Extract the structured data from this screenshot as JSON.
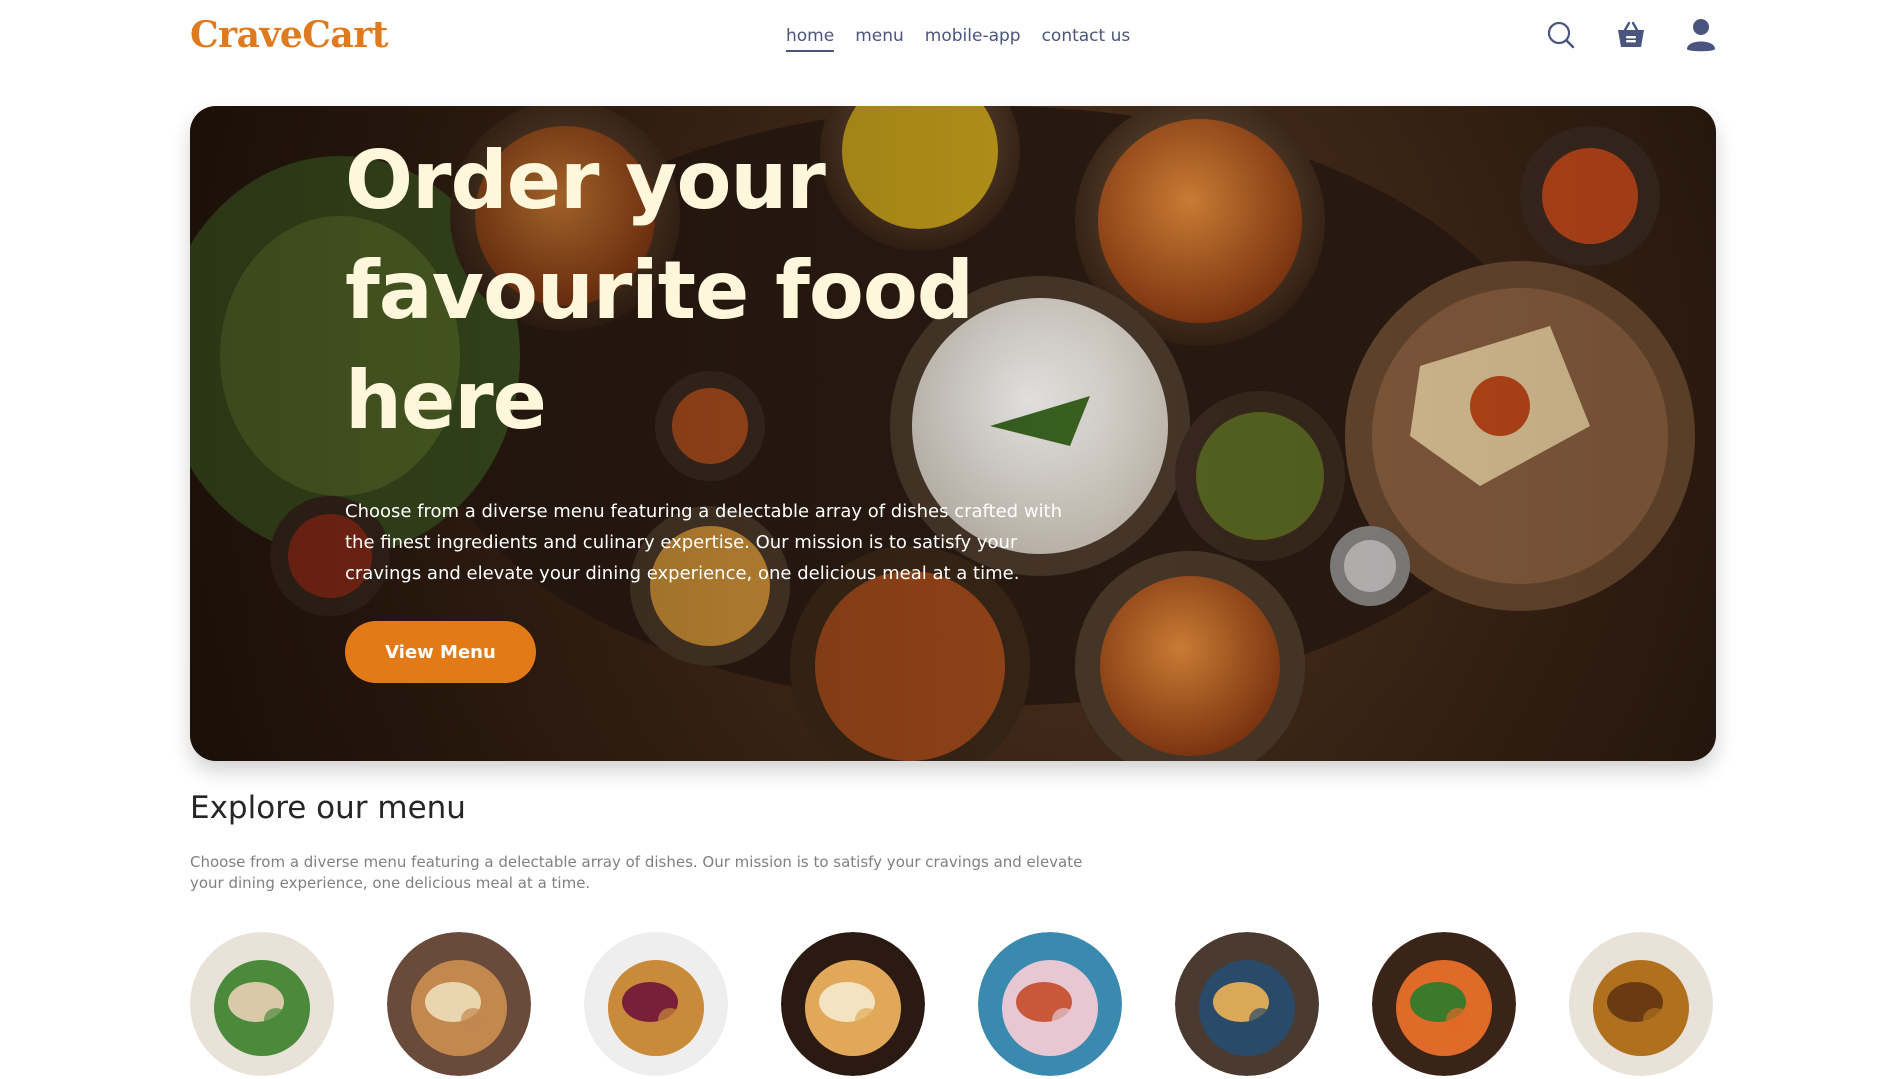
{
  "navbar": {
    "logo": "CraveCart",
    "links": [
      {
        "label": "home",
        "active": true
      },
      {
        "label": "menu",
        "active": false
      },
      {
        "label": "mobile-app",
        "active": false
      },
      {
        "label": "contact us",
        "active": false
      }
    ],
    "icons": [
      "search-icon",
      "basket-icon",
      "profile-icon"
    ]
  },
  "hero": {
    "title": "Order your favourite food here",
    "text": "Choose from a diverse menu featuring a delectable array of dishes crafted with the finest ingredients and culinary expertise. Our mission is to satisfy your cravings and elevate your dining experience, one delicious meal at a time.",
    "button_label": "View Menu"
  },
  "explore": {
    "title": "Explore our menu",
    "text": "Choose from a diverse menu featuring a delectable array of dishes. Our mission is to satisfy your cravings and elevate your dining experience, one delicious meal at a time."
  },
  "menu_items": [
    {
      "icon": "salad-icon",
      "colors": [
        "#e8e2d8",
        "#4a8a3a",
        "#d9c9a8"
      ]
    },
    {
      "icon": "roll-icon",
      "colors": [
        "#6a4a3a",
        "#c2884e",
        "#e9d6b0"
      ]
    },
    {
      "icon": "dessert-icon",
      "colors": [
        "#eeeeee",
        "#c98a3a",
        "#7a1f3a"
      ]
    },
    {
      "icon": "sandwich-icon",
      "colors": [
        "#2a1a12",
        "#e0a858",
        "#f3e3c0"
      ]
    },
    {
      "icon": "cake-icon",
      "colors": [
        "#3a8ab0",
        "#e6c7d2",
        "#c9583a"
      ]
    },
    {
      "icon": "rice-bowl-icon",
      "colors": [
        "#4a3a30",
        "#2a4a6a",
        "#d9a858"
      ]
    },
    {
      "icon": "pasta-icon",
      "colors": [
        "#3a2418",
        "#e06a28",
        "#3a7a2a"
      ]
    },
    {
      "icon": "noodles-icon",
      "colors": [
        "#e8e2d8",
        "#b0701e",
        "#6a3a12"
      ]
    }
  ]
}
